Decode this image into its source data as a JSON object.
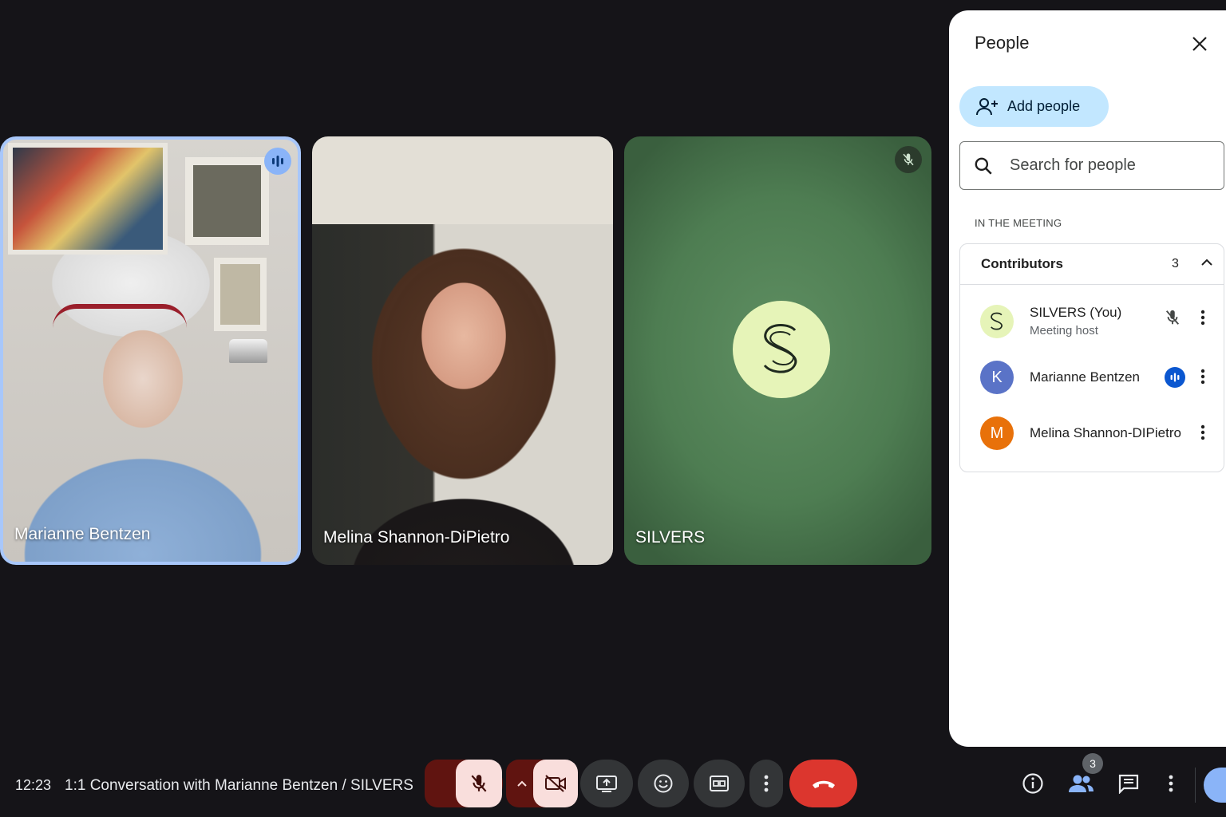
{
  "tiles": [
    {
      "name": "Marianne Bentzen",
      "speaking": true
    },
    {
      "name": "Melina Shannon-DiPietro",
      "speaking": false
    },
    {
      "name": "SILVERS",
      "avatar_letter": "S",
      "muted": true
    }
  ],
  "panel": {
    "title": "People",
    "add_people_label": "Add people",
    "search_placeholder": "Search for people",
    "section_label": "IN THE MEETING",
    "group_label": "Contributors",
    "group_count": "3",
    "people": [
      {
        "name": "SILVERS (You)",
        "subtitle": "Meeting host",
        "avatar": "S",
        "avatar_color": "#e6f4b8",
        "status": "mic-off"
      },
      {
        "name": "Marianne Bentzen",
        "avatar": "K",
        "avatar_color": "#5a73c7",
        "status": "speaking"
      },
      {
        "name": "Melina Shannon-DIPietro",
        "avatar": "M",
        "avatar_color": "#e8710a",
        "status": "none"
      }
    ]
  },
  "bottom_bar": {
    "time": "12:23",
    "meeting_title": "1:1 Conversation with Marianne Bentzen / SILVERS",
    "people_count": "3",
    "icons": [
      "mic-off-icon",
      "chevron-up-icon",
      "camera-off-icon",
      "present-icon",
      "emoji-icon",
      "captions-icon",
      "more-icon",
      "hang-up-icon",
      "info-icon",
      "people-icon",
      "chat-icon",
      "more-icon"
    ]
  },
  "colors": {
    "background": "#151418",
    "accent_blue": "#8ab4f8",
    "hangup_red": "#dc362e",
    "muted_pink": "#f9dedc",
    "add_button": "#c2e7ff"
  }
}
